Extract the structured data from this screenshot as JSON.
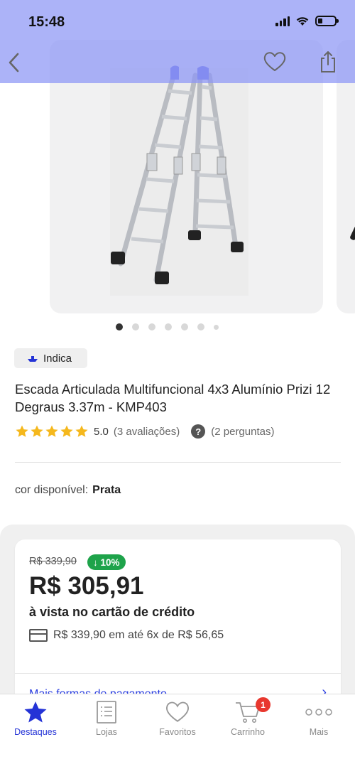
{
  "status_bar": {
    "time": "15:48"
  },
  "nav": {
    "back_icon": "chevron-left-icon",
    "favorite_icon": "heart-icon",
    "share_icon": "share-icon"
  },
  "gallery": {
    "image_count": 7,
    "active_index": 0,
    "image_description_icon": "ladder-image"
  },
  "product": {
    "badge": "Indica",
    "title": "Escada Articulada Multifuncional 4x3 Alumínio Prizi 12 Degraus 3.37m - KMP403",
    "rating": "5.0",
    "stars": 5,
    "reviews": "(3 avaliações)",
    "questions": "(2 perguntas)",
    "question_icon_text": "?",
    "color_label": "cor disponível:",
    "color_value": "Prata"
  },
  "price": {
    "old_price": "R$ 339,90",
    "discount": "↓ 10%",
    "current_price": "R$ 305,91",
    "payment_label": "à vista no cartão de crédito",
    "installment": "R$ 339,90 em até 6x de R$ 56,65",
    "more_payments": "Mais formas de pagamento",
    "more_arrow": "›"
  },
  "tabs": [
    {
      "label": "Destaques",
      "icon": "star-icon",
      "active": true
    },
    {
      "label": "Lojas",
      "icon": "list-icon",
      "active": false
    },
    {
      "label": "Favoritos",
      "icon": "heart-icon",
      "active": false
    },
    {
      "label": "Carrinho",
      "icon": "cart-icon",
      "active": false,
      "badge": "1"
    },
    {
      "label": "Mais",
      "icon": "more-icon",
      "active": false
    }
  ],
  "colors": {
    "accent": "#2433d6",
    "header_overlay": "#8c96f5",
    "discount_green": "#1ea34a",
    "star_yellow": "#f5b81d",
    "cart_badge": "#e8372e"
  }
}
